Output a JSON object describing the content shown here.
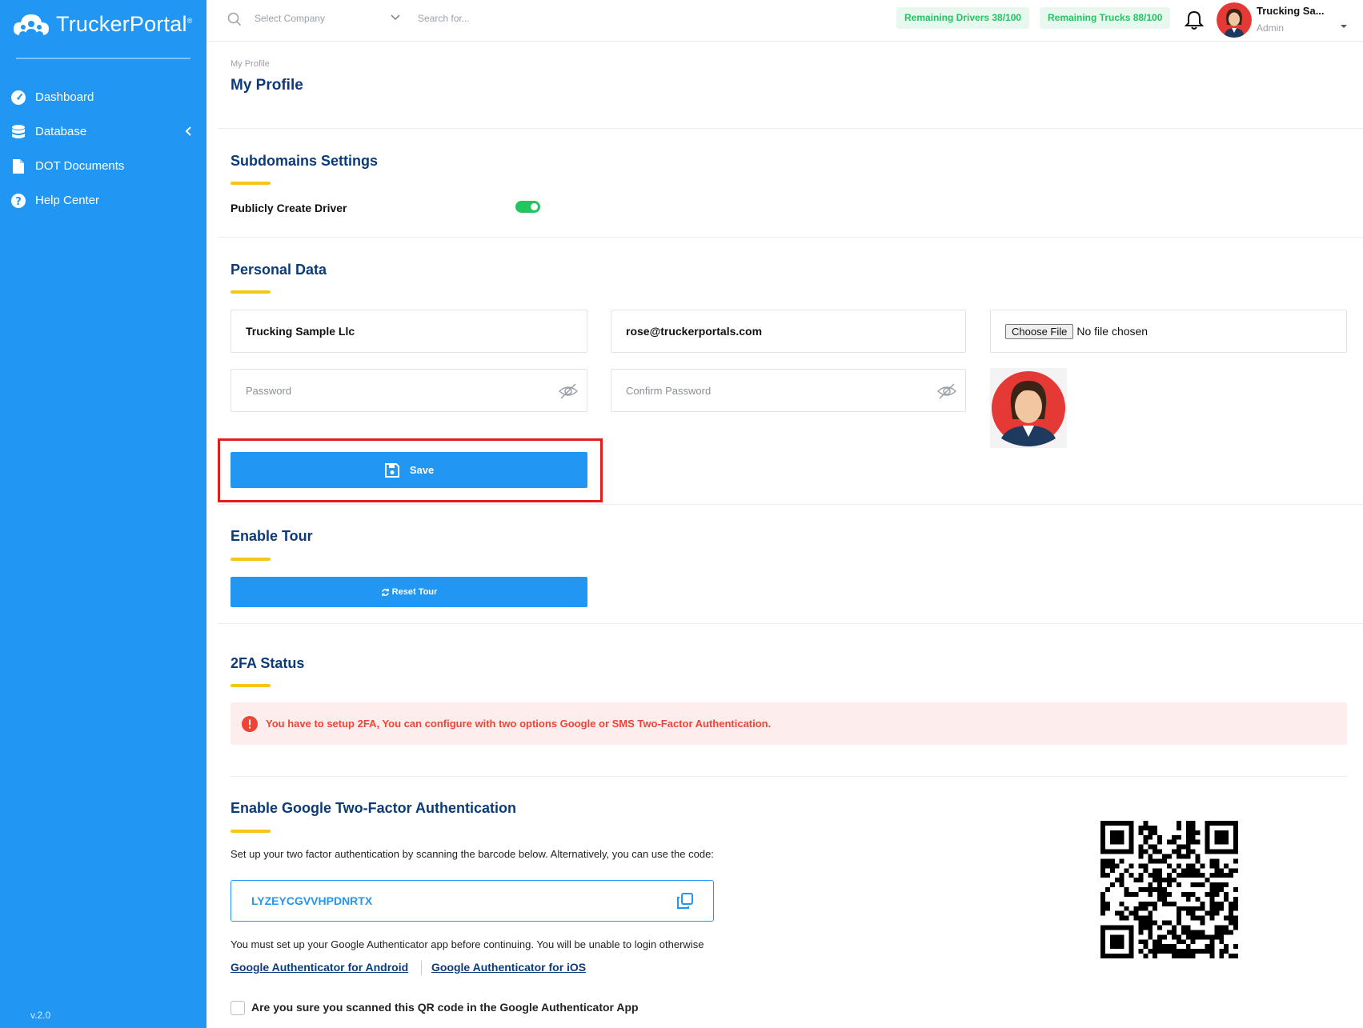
{
  "brand": {
    "name": "TruckerPortal",
    "mark": "®"
  },
  "sidebar": {
    "items": [
      {
        "label": "Dashboard",
        "icon": "dashboard-gauge-icon"
      },
      {
        "label": "Database",
        "icon": "database-icon"
      },
      {
        "label": "DOT Documents",
        "icon": "document-icon"
      },
      {
        "label": "Help Center",
        "icon": "help-circle-icon"
      }
    ],
    "version": "v.2.0"
  },
  "topbar": {
    "company_placeholder": "Select Company",
    "search_placeholder": "Search for...",
    "remaining_drivers": "Remaining Drivers 38/100",
    "remaining_trucks": "Remaining Trucks 88/100",
    "user_name": "Trucking Sa...",
    "user_role": "Admin"
  },
  "breadcrumb": "My Profile",
  "page_title": "My Profile",
  "subdomains": {
    "title": "Subdomains Settings",
    "publicly_create_driver_label": "Publicly Create Driver",
    "publicly_create_driver_on": true
  },
  "personal": {
    "title": "Personal Data",
    "company_name": "Trucking Sample Llc",
    "email": "rose@truckerportals.com",
    "choose_file_label": "Choose File",
    "no_file_label": "No file chosen",
    "password_placeholder": "Password",
    "confirm_password_placeholder": "Confirm Password",
    "save_label": "Save"
  },
  "tour": {
    "title": "Enable Tour",
    "reset_label": "Reset Tour"
  },
  "twofa": {
    "title": "2FA Status",
    "alert": "You have to setup 2FA, You can configure with two options Google or SMS Two-Factor Authentication."
  },
  "google2fa": {
    "title": "Enable Google Two-Factor Authentication",
    "instructions": "Set up your two factor authentication by scanning the barcode below. Alternatively, you can use the code:",
    "code": "LYZEYCGVVHPDNRTX",
    "warning": "You must set up your Google Authenticator app before continuing. You will be unable to login otherwise",
    "android_link": "Google Authenticator for Android",
    "ios_link": "Google Authenticator for iOS",
    "confirm_label": "Are you sure you scanned this QR code in the Google Authenticator App"
  },
  "colors": {
    "sidebar": "#2196f3",
    "heading": "#0d3b78",
    "accent_yellow": "#f5c518",
    "success": "#22c55e",
    "danger": "#ef4433"
  }
}
